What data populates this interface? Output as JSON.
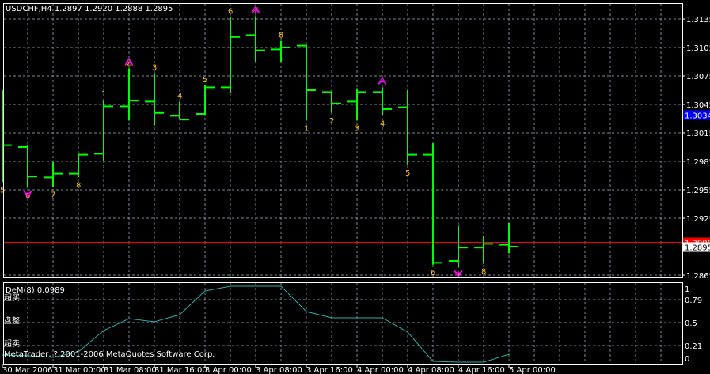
{
  "header": {
    "symbol": "USDCHF,H4",
    "open": "1.2897",
    "high": "1.2920",
    "low": "1.2888",
    "close": "1.2895"
  },
  "indicator": {
    "title": "DeM(8) 0.0989",
    "zone_overbought": "超买",
    "zone_neutral": "盘整",
    "zone_oversold": "超卖",
    "copyright": "MetaTrader, ? 2001-2006 MetaQuotes Software Corp."
  },
  "colors": {
    "background": "#000000",
    "bars": "#00ff00",
    "grid": "#778899",
    "labels": "#ffc000",
    "arrows": "#ff00ff",
    "dem_line": "#20b2aa",
    "blue_line": "#0000ff",
    "red_line": "#ff0000"
  },
  "chart_data": [
    {
      "type": "ohlc",
      "title": "USDCHF,H4",
      "x": [
        "30 Mar 2006 20:00",
        "31 Mar 00:00",
        "31 Mar 04:00",
        "31 Mar 08:00",
        "31 Mar 12:00",
        "31 Mar 16:00",
        "31 Mar 20:00",
        "3 Apr 00:00",
        "3 Apr 04:00",
        "3 Apr 08:00",
        "3 Apr 12:00",
        "3 Apr 16:00",
        "3 Apr 20:00",
        "4 Apr 00:00",
        "4 Apr 04:00",
        "4 Apr 08:00",
        "4 Apr 12:00",
        "4 Apr 16:00",
        "4 Apr 20:00",
        "5 Apr 00:00",
        "5 Apr 04:00"
      ],
      "open": [
        1.3002,
        1.3,
        1.2968,
        1.2972,
        1.2993,
        1.3043,
        1.3048,
        1.3033,
        1.3035,
        1.3063,
        1.3118,
        1.3103,
        1.3107,
        1.3058,
        1.3048,
        1.3058,
        1.3042,
        1.2992,
        1.288,
        1.2894,
        1.2897
      ],
      "high": [
        1.306,
        1.3002,
        1.2984,
        1.2993,
        1.305,
        1.3083,
        1.3078,
        1.3048,
        1.3065,
        1.3137,
        1.3138,
        1.3112,
        1.3108,
        1.3058,
        1.3062,
        1.3063,
        1.306,
        1.3004,
        1.2917,
        1.2906,
        1.292
      ],
      "low": [
        1.2963,
        1.2957,
        1.2958,
        1.2968,
        1.2985,
        1.3028,
        1.3023,
        1.3029,
        1.3033,
        1.3057,
        1.309,
        1.309,
        1.3028,
        1.3036,
        1.3028,
        1.3033,
        1.2981,
        1.2876,
        1.2873,
        1.2877,
        1.2888
      ],
      "close": [
        1.3002,
        1.2969,
        1.2972,
        1.2992,
        1.3043,
        1.3049,
        1.3036,
        1.3029,
        1.3063,
        1.3116,
        1.3102,
        1.3105,
        1.306,
        1.3046,
        1.3058,
        1.304,
        1.2992,
        1.2878,
        1.2894,
        1.2898,
        1.2895
      ],
      "bar_labels": [
        "5",
        "6",
        "7",
        "8",
        "1",
        "2",
        "3",
        "4",
        "5",
        "6",
        "7",
        "8",
        "1",
        "2",
        "3",
        "4",
        "5",
        "6",
        "7",
        "8",
        ""
      ],
      "label_positions": [
        "below",
        "below",
        "below",
        "below",
        "above",
        "above",
        "above",
        "above",
        "above",
        "above",
        "above",
        "above",
        "below",
        "below",
        "below",
        "below",
        "below",
        "below",
        "below",
        "below",
        ""
      ],
      "arrows": [
        {
          "bar": 1,
          "dir": "down"
        },
        {
          "bar": 5,
          "dir": "up"
        },
        {
          "bar": 10,
          "dir": "up"
        },
        {
          "bar": 15,
          "dir": "up"
        },
        {
          "bar": 18,
          "dir": "down"
        }
      ],
      "y_ticks": [
        "1.3135",
        "1.3105",
        "1.3075",
        "1.3045",
        "1.3015",
        "1.2985",
        "1.2955",
        "1.2925",
        "1.2865"
      ],
      "ylim": [
        1.2862,
        1.315
      ],
      "hlines": [
        {
          "value": "1.3034",
          "color": "#0000ff"
        },
        {
          "value": "1.2900",
          "color": "#ff0000"
        },
        {
          "value": "1.2895",
          "color": "#c0c0c0"
        }
      ],
      "x_tick_labels": [
        "30 Mar 2006",
        "31 Mar 00:00",
        "31 Mar 08:00",
        "31 Mar 16:00",
        "3 Apr 00:00",
        "3 Apr 08:00",
        "3 Apr 16:00",
        "4 Apr 00:00",
        "4 Apr 08:00",
        "4 Apr 16:00",
        "5 Apr 00:00"
      ],
      "grid": true
    },
    {
      "type": "line",
      "title": "DeM(8) 0.0989",
      "values": [
        0.09,
        0.08,
        0.06,
        0.13,
        0.4,
        0.55,
        0.51,
        0.6,
        0.9,
        0.96,
        0.96,
        0.96,
        0.64,
        0.56,
        0.56,
        0.56,
        0.38,
        0.01,
        0.0,
        0.0,
        0.0989
      ],
      "y_ticks": [
        "1",
        "0.79",
        "0.5",
        "0.21",
        "0"
      ],
      "ylim": [
        0,
        1
      ],
      "grid": true
    }
  ]
}
